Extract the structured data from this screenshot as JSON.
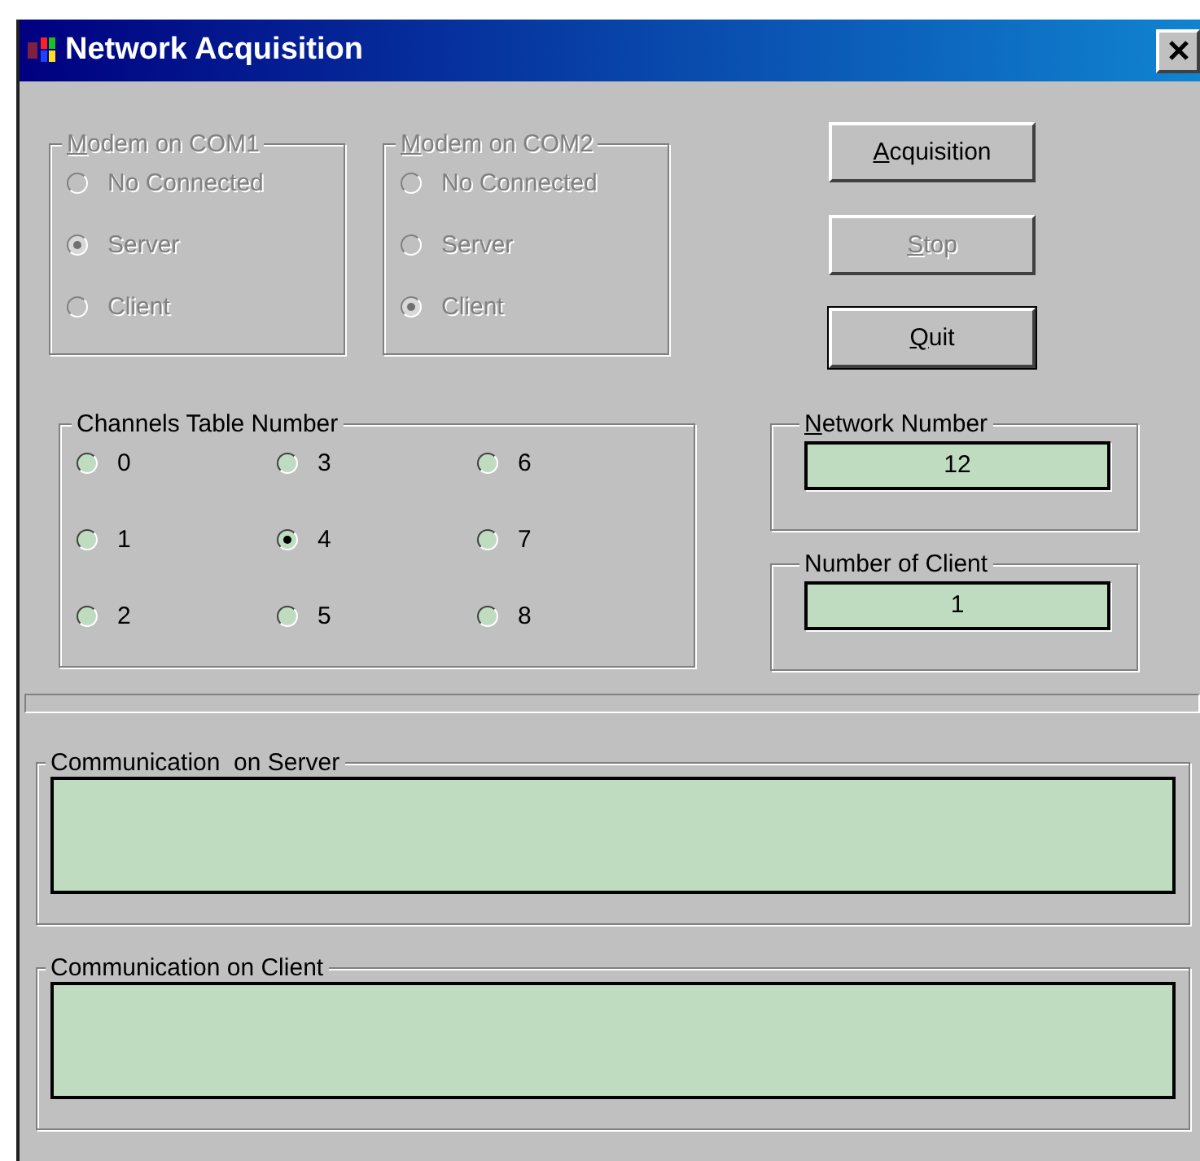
{
  "window": {
    "title": "Network Acquisition"
  },
  "modems": [
    {
      "key": "M",
      "rest": "odem on COM1",
      "disabled": true,
      "options": [
        {
          "label": "No Connected",
          "selected": false
        },
        {
          "label": "Server",
          "selected": true
        },
        {
          "label": "Client",
          "selected": false
        }
      ]
    },
    {
      "key": "M",
      "rest": "odem on COM2",
      "disabled": true,
      "options": [
        {
          "label": "No Connected",
          "selected": false
        },
        {
          "label": "Server",
          "selected": false
        },
        {
          "label": "Client",
          "selected": true
        }
      ]
    }
  ],
  "buttons": [
    {
      "key": "A",
      "rest": "cquisition",
      "disabled": false,
      "focused": false
    },
    {
      "key": "S",
      "rest": "top",
      "disabled": true,
      "focused": false
    },
    {
      "key": "Q",
      "rest": "uit",
      "disabled": false,
      "focused": true
    }
  ],
  "channels": {
    "label": "Channels Table Number",
    "options": [
      {
        "label": "0",
        "selected": false
      },
      {
        "label": "1",
        "selected": false
      },
      {
        "label": "2",
        "selected": false
      },
      {
        "label": "3",
        "selected": false
      },
      {
        "label": "4",
        "selected": true
      },
      {
        "label": "5",
        "selected": false
      },
      {
        "label": "6",
        "selected": false
      },
      {
        "label": "7",
        "selected": false
      },
      {
        "label": "8",
        "selected": false
      }
    ]
  },
  "network_number": {
    "key": "N",
    "rest": "etwork Number",
    "value": "12"
  },
  "number_of_client": {
    "label": "Number of Client",
    "value": "1"
  },
  "communication": [
    {
      "label": "Communication  on Server"
    },
    {
      "label": "Communication on Client"
    }
  ]
}
